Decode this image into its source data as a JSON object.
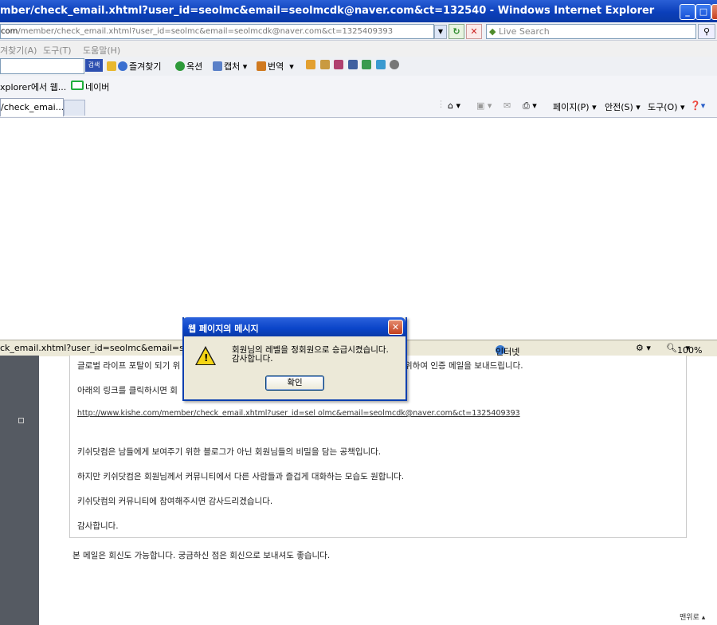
{
  "window": {
    "title": "mber/check_email.xhtml?user_id=seolmc&email=seolmcdk@naver.com&ct=132540 - Windows Internet Explorer"
  },
  "address_bar": {
    "url_host": "com",
    "url_path": "/member/check_email.xhtml?user_id=seolmc&email=seolmcdk@naver.com&ct=1325409393",
    "search_placeholder": "Live Search"
  },
  "menu": [
    "겨찾기(A)",
    "도구(T)",
    "도움말(H)"
  ],
  "toolbar": {
    "search_button": "검색",
    "favorites": "즐겨찾기",
    "options": "옥션",
    "capture": "캡처",
    "translate": "번역"
  },
  "favorites_bar": {
    "item1": "xplorer에서 웹...",
    "item2": "네이버"
  },
  "tab": {
    "label": "/check_emai..."
  },
  "command_bar": {
    "page": "페이지(P)",
    "safety": "안전(S)",
    "tools": "도구(O)"
  },
  "status_bar": {
    "url": "ck_email.xhtml?user_id=seolmc&email=seolmc",
    "zone": "인터넷",
    "zoom": "100%"
  },
  "dialog": {
    "title": "웹 페이지의 메시지",
    "message_line1": "회원님의 레벨을 정회원으로 승급시켰습니다.",
    "message_line2": "감사합니다.",
    "ok_label": "확인"
  },
  "email": {
    "line1_left": "글로벌 라이프 포탈이 되기 위",
    "line1_right": "위하여 인증 메일을 보내드립니다.",
    "line2": "아래의 링크를 클릭하시면 회",
    "link": "http://www.kishe.com/member/check_email.xhtml?user_id=sel olmc&email=seolmcdk@naver.com&ct=1325409393",
    "line3": "키쉬닷컴은 남들에게 보여주기 위한 블로그가 아닌 회원님들의 비밀을 담는 공책입니다.",
    "line4": "하지만 키쉬닷컴은 회원님께서 커뮤니티에서 다른 사람들과 즐겁게 대화하는 모습도 원합니다.",
    "line5": "키쉬닷컴의 커뮤니티에 참여해주시면 감사드리겠습니다.",
    "line6": "감사합니다.",
    "footer": "본 메일은 회신도 가능합니다. 궁금하신 점은 회신으로 보내셔도 좋습니다.",
    "top_link": "맨위로 ▴"
  }
}
